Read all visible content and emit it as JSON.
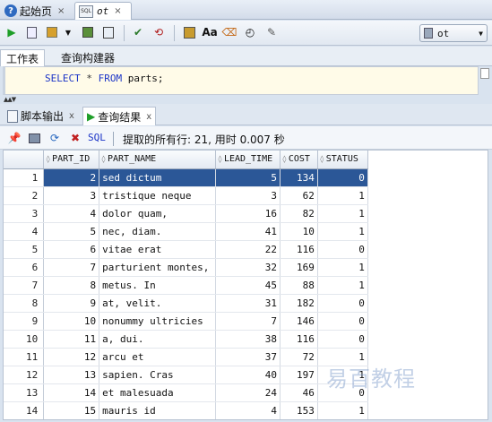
{
  "doc_tabs": [
    {
      "label": "起始页",
      "icon": "help-icon"
    },
    {
      "label": "ot",
      "icon": "sql-worksheet-icon"
    }
  ],
  "connection": {
    "selected": "ot"
  },
  "worksheet_tabs": [
    {
      "label": "工作表"
    },
    {
      "label": "查询构建器"
    }
  ],
  "editor": {
    "keyword_select": "SELECT",
    "star": "*",
    "keyword_from": "FROM",
    "rest": "parts;"
  },
  "result_tabs": [
    {
      "label": "脚本输出",
      "close": "x"
    },
    {
      "label": "查询结果",
      "close": "x"
    }
  ],
  "result_toolbar": {
    "sql_label": "SQL",
    "status": "提取的所有行: 21, 用时 0.007 秒"
  },
  "grid": {
    "columns": [
      "PART_ID",
      "PART_NAME",
      "LEAD_TIME",
      "COST",
      "STATUS"
    ],
    "rows": [
      {
        "n": "1",
        "part_id": "2",
        "part_name": "sed dictum",
        "lead_time": "5",
        "cost": "134",
        "status": "0"
      },
      {
        "n": "2",
        "part_id": "3",
        "part_name": "tristique neque",
        "lead_time": "3",
        "cost": "62",
        "status": "1"
      },
      {
        "n": "3",
        "part_id": "4",
        "part_name": "dolor quam,",
        "lead_time": "16",
        "cost": "82",
        "status": "1"
      },
      {
        "n": "4",
        "part_id": "5",
        "part_name": "nec, diam.",
        "lead_time": "41",
        "cost": "10",
        "status": "1"
      },
      {
        "n": "5",
        "part_id": "6",
        "part_name": "vitae erat",
        "lead_time": "22",
        "cost": "116",
        "status": "0"
      },
      {
        "n": "6",
        "part_id": "7",
        "part_name": "parturient montes,",
        "lead_time": "32",
        "cost": "169",
        "status": "1"
      },
      {
        "n": "7",
        "part_id": "8",
        "part_name": "metus. In",
        "lead_time": "45",
        "cost": "88",
        "status": "1"
      },
      {
        "n": "8",
        "part_id": "9",
        "part_name": "at, velit.",
        "lead_time": "31",
        "cost": "182",
        "status": "0"
      },
      {
        "n": "9",
        "part_id": "10",
        "part_name": "nonummy ultricies",
        "lead_time": "7",
        "cost": "146",
        "status": "0"
      },
      {
        "n": "10",
        "part_id": "11",
        "part_name": "a, dui.",
        "lead_time": "38",
        "cost": "116",
        "status": "0"
      },
      {
        "n": "11",
        "part_id": "12",
        "part_name": "arcu et",
        "lead_time": "37",
        "cost": "72",
        "status": "1"
      },
      {
        "n": "12",
        "part_id": "13",
        "part_name": "sapien. Cras",
        "lead_time": "40",
        "cost": "197",
        "status": "1"
      },
      {
        "n": "13",
        "part_id": "14",
        "part_name": "et malesuada",
        "lead_time": "24",
        "cost": "46",
        "status": "0"
      },
      {
        "n": "14",
        "part_id": "15",
        "part_name": "mauris id",
        "lead_time": "4",
        "cost": "153",
        "status": "1"
      }
    ]
  },
  "watermark": "易百教程"
}
